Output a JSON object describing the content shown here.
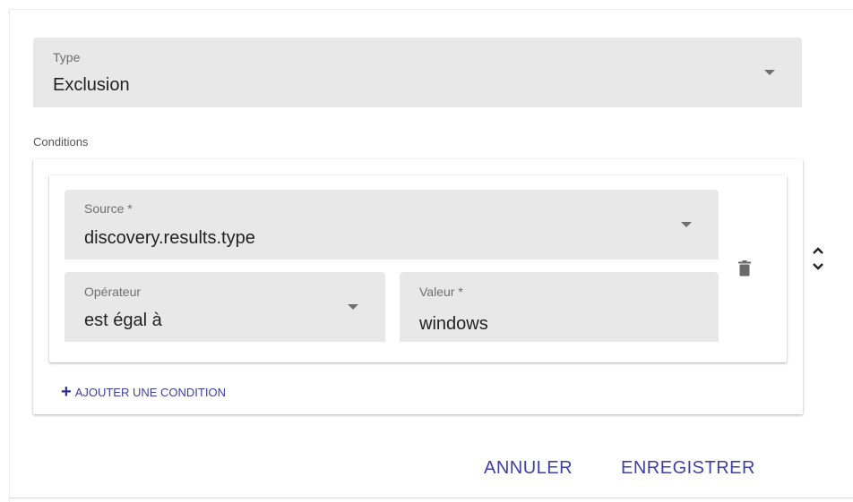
{
  "type_field": {
    "label": "Type",
    "value": "Exclusion"
  },
  "conditions": {
    "section_label": "Conditions",
    "items": [
      {
        "source": {
          "label": "Source *",
          "value": "discovery.results.type"
        },
        "operator": {
          "label": "Opérateur",
          "value": "est égal à"
        },
        "value": {
          "label": "Valeur *",
          "value": "windows"
        }
      }
    ],
    "add_label": "AJOUTER UNE CONDITION",
    "add_icon": "plus-icon",
    "delete_icon": "trash-icon",
    "reorder_icons": [
      "chevron-up-icon",
      "chevron-down-icon"
    ]
  },
  "actions": {
    "cancel_label": "ANNULER",
    "save_label": "ENREGISTRER"
  },
  "colors": {
    "field_bg": "#e8e8e8",
    "accent": "#3f3fa8"
  }
}
